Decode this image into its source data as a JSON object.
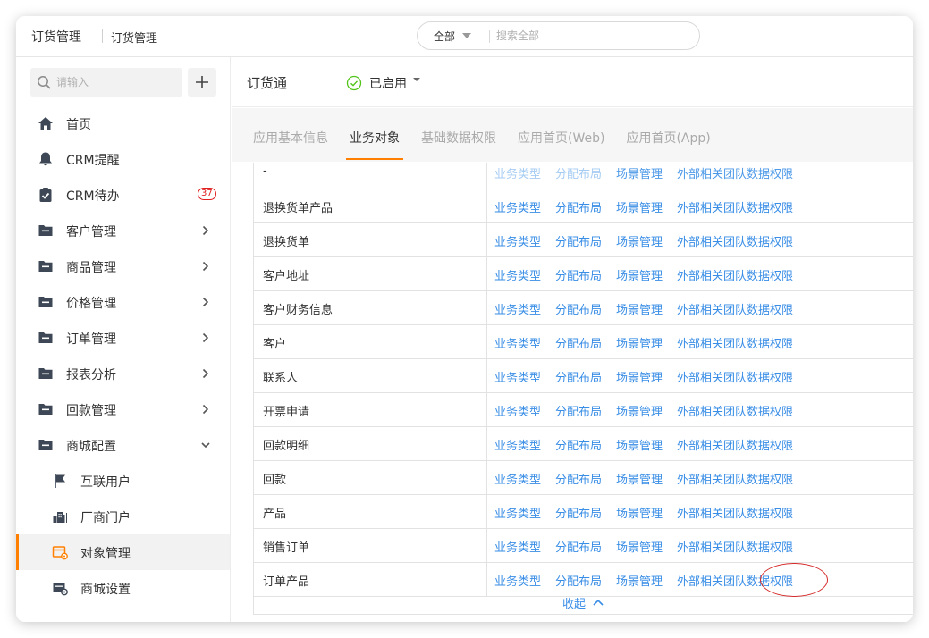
{
  "topbar": {
    "app_title": "订货管理",
    "breadcrumb": "订货管理",
    "search_scope": "全部",
    "search_placeholder": "搜索全部"
  },
  "sidebar": {
    "search_placeholder": "请输入",
    "add_icon": "plus-icon",
    "items": [
      {
        "label": "首页",
        "icon": "home-icon"
      },
      {
        "label": "CRM提醒",
        "icon": "bell-icon"
      },
      {
        "label": "CRM待办",
        "icon": "clipboard-check-icon",
        "badge": "37"
      },
      {
        "label": "客户管理",
        "icon": "folder-icon",
        "expandable": true
      },
      {
        "label": "商品管理",
        "icon": "folder-icon",
        "expandable": true
      },
      {
        "label": "价格管理",
        "icon": "folder-icon",
        "expandable": true
      },
      {
        "label": "订单管理",
        "icon": "folder-icon",
        "expandable": true
      },
      {
        "label": "报表分析",
        "icon": "folder-icon",
        "expandable": true
      },
      {
        "label": "回款管理",
        "icon": "folder-icon",
        "expandable": true
      },
      {
        "label": "商城配置",
        "icon": "folder-icon",
        "expanded": true
      },
      {
        "label": "互联用户",
        "icon": "flag-icon"
      },
      {
        "label": "厂商门户",
        "icon": "buildings-icon"
      },
      {
        "label": "对象管理",
        "icon": "object-settings-icon",
        "active": true
      },
      {
        "label": "商城设置",
        "icon": "store-settings-icon"
      }
    ]
  },
  "main": {
    "title": "订货通",
    "status": "已启用",
    "tabs": [
      "应用基本信息",
      "业务对象",
      "基础数据权限",
      "应用首页(Web)",
      "应用首页(App)"
    ],
    "active_tab": "业务对象",
    "link_labels": [
      "业务类型",
      "分配布局",
      "场景管理",
      "外部相关团队数据权限"
    ],
    "rows": [
      "-",
      "退换货单产品",
      "退换货单",
      "客户地址",
      "客户财务信息",
      "客户",
      "联系人",
      "开票申请",
      "回款明细",
      "回款",
      "产品",
      "销售订单",
      "订单产品"
    ],
    "collapse_label": "收起"
  },
  "colors": {
    "accent": "#ff8000",
    "link": "#3a8ee6",
    "badge": "#e02020",
    "enabled": "#52c41a",
    "annotation": "#d52b2b"
  }
}
